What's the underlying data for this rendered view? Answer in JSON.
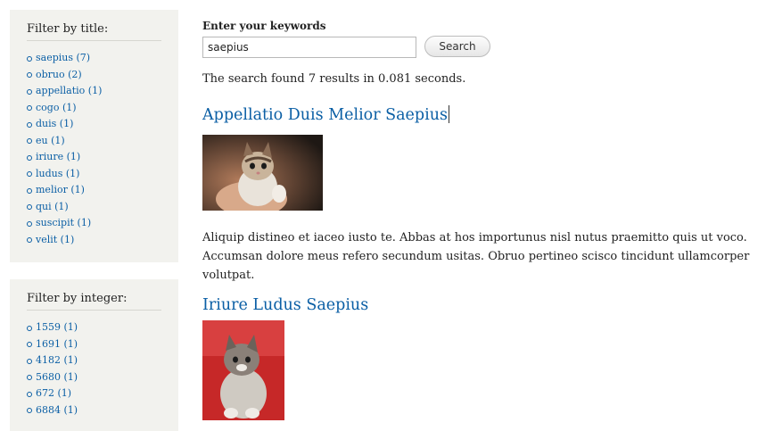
{
  "filter_title": {
    "heading": "Filter by title:",
    "items": [
      {
        "label": "saepius (7)"
      },
      {
        "label": "obruo (2)"
      },
      {
        "label": "appellatio (1)"
      },
      {
        "label": "cogo (1)"
      },
      {
        "label": "duis (1)"
      },
      {
        "label": "eu (1)"
      },
      {
        "label": "iriure (1)"
      },
      {
        "label": "ludus (1)"
      },
      {
        "label": "melior (1)"
      },
      {
        "label": "qui (1)"
      },
      {
        "label": "suscipit (1)"
      },
      {
        "label": "velit (1)"
      }
    ]
  },
  "filter_integer": {
    "heading": "Filter by integer:",
    "items": [
      {
        "label": "1559 (1)"
      },
      {
        "label": "1691 (1)"
      },
      {
        "label": "4182 (1)"
      },
      {
        "label": "5680 (1)"
      },
      {
        "label": "672 (1)"
      },
      {
        "label": "6884 (1)"
      }
    ]
  },
  "search": {
    "label": "Enter your keywords",
    "value": "saepius",
    "button_label": "Search",
    "summary": "The search found 7 results in 0.081 seconds."
  },
  "results": [
    {
      "title": "Appellatio Duis Melior Saepius",
      "snippet": "Aliquip distineo et iaceo iusto te. Abbas at hos importunus nisl nutus praemitto quis ut voco. Accumsan dolore meus refero secundum usitas. Obruo pertineo scisco tincidunt ullamcorper volutpat."
    },
    {
      "title": "Iriure Ludus Saepius"
    }
  ]
}
